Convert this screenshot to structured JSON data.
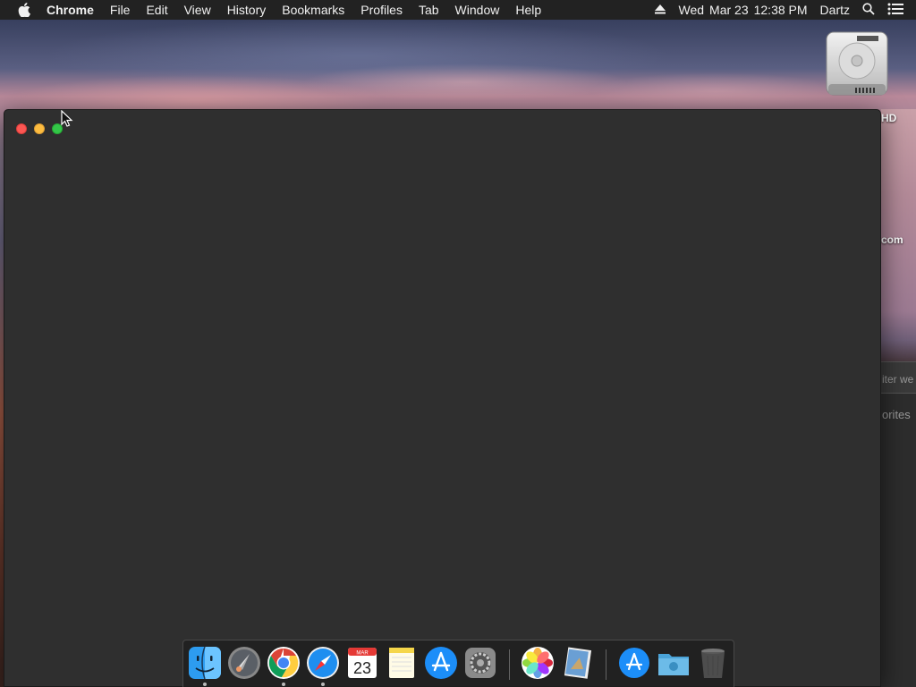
{
  "menubar": {
    "app_name": "Chrome",
    "menus": [
      "File",
      "Edit",
      "View",
      "History",
      "Bookmarks",
      "Profiles",
      "Tab",
      "Window",
      "Help"
    ],
    "clock": {
      "day": "Wed",
      "date": "Mar 23",
      "time": "12:38 PM"
    },
    "user": "Dartz"
  },
  "desktop": {
    "drive_label_partial": "HD",
    "item_label_partial": "com",
    "finder_search_partial": "iter we",
    "finder_favorites_partial": "orites"
  },
  "window": {
    "background": "#2f2f2f"
  },
  "dock": {
    "items": [
      {
        "name": "finder-dock-icon",
        "running": true
      },
      {
        "name": "launchpad-dock-icon",
        "running": false
      },
      {
        "name": "chrome-dock-icon",
        "running": true
      },
      {
        "name": "safari-dock-icon",
        "running": true
      },
      {
        "name": "calendar-dock-icon",
        "running": false,
        "month": "MAR",
        "day": "23"
      },
      {
        "name": "notes-dock-icon",
        "running": false
      },
      {
        "name": "app-store-dock-icon",
        "running": false
      },
      {
        "name": "system-preferences-dock-icon",
        "running": false
      },
      {
        "name": "photos-dock-icon",
        "running": false
      },
      {
        "name": "preview-dock-icon",
        "running": false
      },
      {
        "name": "app-store-folder-dock-icon",
        "running": false
      },
      {
        "name": "downloads-folder-dock-icon",
        "running": false
      },
      {
        "name": "trash-dock-icon",
        "running": false
      }
    ]
  },
  "colors": {
    "close": "#fc5753",
    "minimize": "#fdbc40",
    "maximize": "#33c748",
    "menubar": "#222222"
  }
}
